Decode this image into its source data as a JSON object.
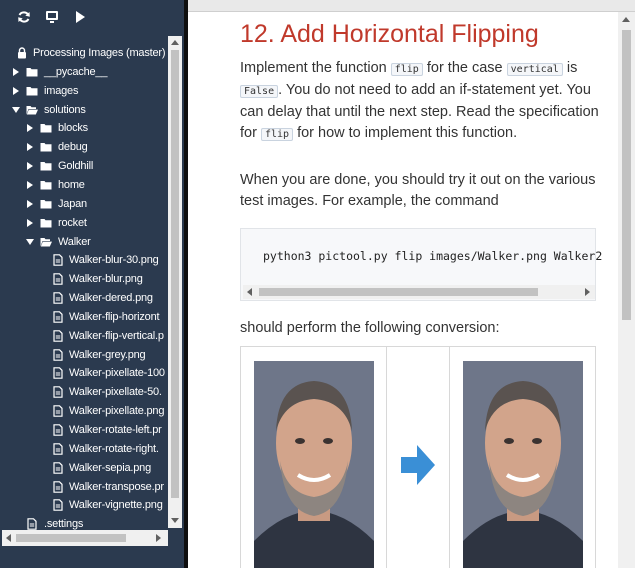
{
  "sidebar": {
    "toolbar": [
      {
        "name": "refresh-button",
        "icon": "refresh-icon"
      },
      {
        "name": "monitor-button",
        "icon": "monitor-icon"
      },
      {
        "name": "run-button",
        "icon": "play-icon"
      }
    ],
    "tree": [
      {
        "label": "Processing Images (master)",
        "icon": "lock-icon",
        "depth": 0,
        "arrow": "none",
        "kind": "root"
      },
      {
        "label": "__pycache__",
        "icon": "folder-icon",
        "depth": 1,
        "arrow": "right",
        "kind": "folder"
      },
      {
        "label": "images",
        "icon": "folder-icon",
        "depth": 1,
        "arrow": "right",
        "kind": "folder"
      },
      {
        "label": "solutions",
        "icon": "folder-open-icon",
        "depth": 1,
        "arrow": "down",
        "kind": "folder"
      },
      {
        "label": "blocks",
        "icon": "folder-icon",
        "depth": 2,
        "arrow": "right",
        "kind": "folder"
      },
      {
        "label": "debug",
        "icon": "folder-icon",
        "depth": 2,
        "arrow": "right",
        "kind": "folder"
      },
      {
        "label": "Goldhill",
        "icon": "folder-icon",
        "depth": 2,
        "arrow": "right",
        "kind": "folder"
      },
      {
        "label": "home",
        "icon": "folder-icon",
        "depth": 2,
        "arrow": "right",
        "kind": "folder"
      },
      {
        "label": "Japan",
        "icon": "folder-icon",
        "depth": 2,
        "arrow": "right",
        "kind": "folder"
      },
      {
        "label": "rocket",
        "icon": "folder-icon",
        "depth": 2,
        "arrow": "right",
        "kind": "folder"
      },
      {
        "label": "Walker",
        "icon": "folder-open-icon",
        "depth": 2,
        "arrow": "down",
        "kind": "folder"
      },
      {
        "label": "Walker-blur-30.png",
        "icon": "file-icon",
        "depth": 3,
        "arrow": "none",
        "kind": "file"
      },
      {
        "label": "Walker-blur.png",
        "icon": "file-icon",
        "depth": 3,
        "arrow": "none",
        "kind": "file"
      },
      {
        "label": "Walker-dered.png",
        "icon": "file-icon",
        "depth": 3,
        "arrow": "none",
        "kind": "file"
      },
      {
        "label": "Walker-flip-horizont",
        "icon": "file-icon",
        "depth": 3,
        "arrow": "none",
        "kind": "file"
      },
      {
        "label": "Walker-flip-vertical.p",
        "icon": "file-icon",
        "depth": 3,
        "arrow": "none",
        "kind": "file"
      },
      {
        "label": "Walker-grey.png",
        "icon": "file-icon",
        "depth": 3,
        "arrow": "none",
        "kind": "file"
      },
      {
        "label": "Walker-pixellate-100",
        "icon": "file-icon",
        "depth": 3,
        "arrow": "none",
        "kind": "file"
      },
      {
        "label": "Walker-pixellate-50.",
        "icon": "file-icon",
        "depth": 3,
        "arrow": "none",
        "kind": "file"
      },
      {
        "label": "Walker-pixellate.png",
        "icon": "file-icon",
        "depth": 3,
        "arrow": "none",
        "kind": "file"
      },
      {
        "label": "Walker-rotate-left.pr",
        "icon": "file-icon",
        "depth": 3,
        "arrow": "none",
        "kind": "file"
      },
      {
        "label": "Walker-rotate-right.",
        "icon": "file-icon",
        "depth": 3,
        "arrow": "none",
        "kind": "file"
      },
      {
        "label": "Walker-sepia.png",
        "icon": "file-icon",
        "depth": 3,
        "arrow": "none",
        "kind": "file"
      },
      {
        "label": "Walker-transpose.pr",
        "icon": "file-icon",
        "depth": 3,
        "arrow": "none",
        "kind": "file"
      },
      {
        "label": "Walker-vignette.png",
        "icon": "file-icon",
        "depth": 3,
        "arrow": "none",
        "kind": "file"
      },
      {
        "label": ".settings",
        "icon": "file-icon",
        "depth": 1,
        "arrow": "none",
        "kind": "file"
      }
    ]
  },
  "doc": {
    "title": "12. Add Horizontal Flipping",
    "p1": {
      "t1": "Implement the function ",
      "c1": "flip",
      "t2": " for the case ",
      "c2": "vertical",
      "t3": " is ",
      "c3": "False",
      "t4": ". You do not need to add an if-statement yet. You can delay that until the next step. Read the specification for ",
      "c4": "flip",
      "t5": " for how to implement this function."
    },
    "p2": "When you are done, you should try it out on the various test images. For example, the command",
    "code": "python3 pictool.py flip images/Walker.png Walker2",
    "p3": "should perform the following conversion:",
    "figure": {
      "left_image": "portrait-original",
      "arrow": "right-arrow-icon",
      "right_image": "portrait-flipped"
    }
  },
  "colors": {
    "sidebar_bg": "#2b3a4f",
    "title": "#c0392b",
    "arrow": "#3a8fd6"
  }
}
